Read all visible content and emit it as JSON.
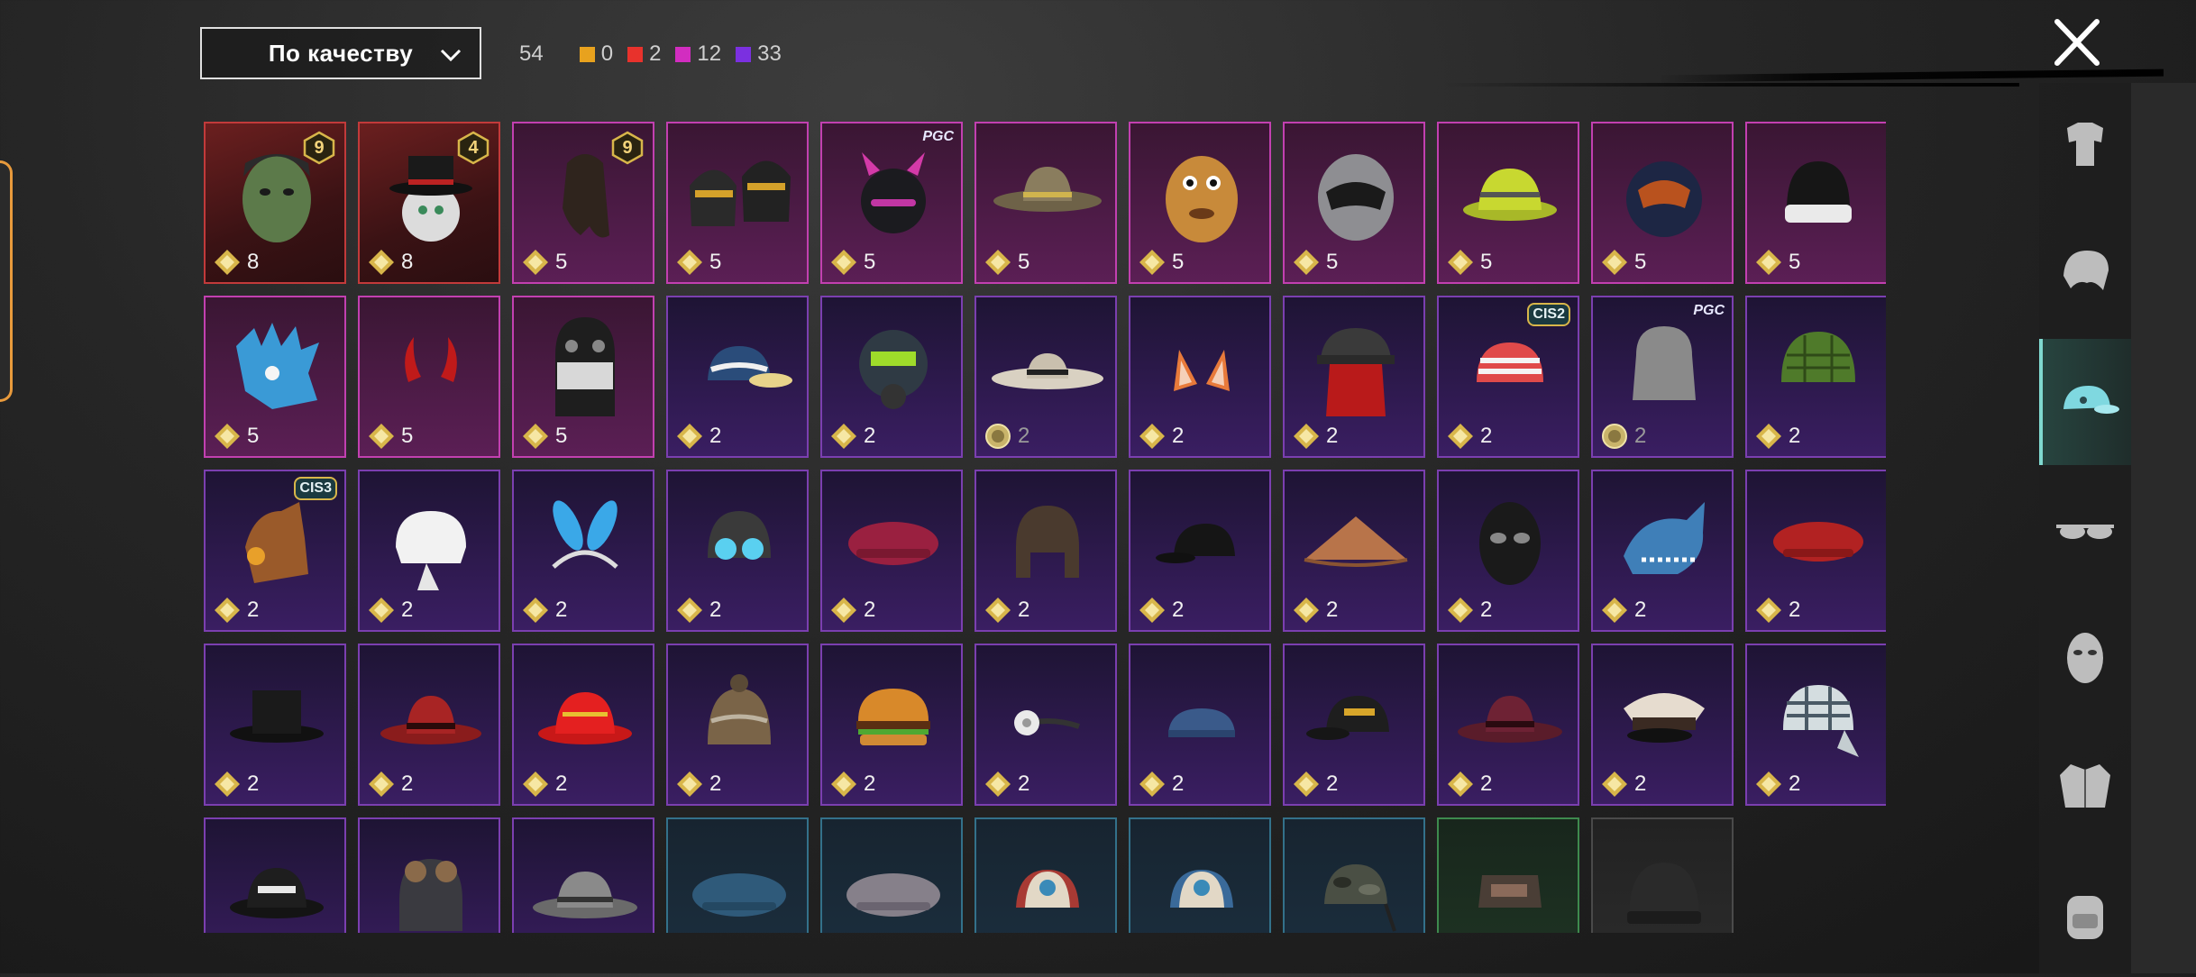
{
  "sort": {
    "label": "По качеству",
    "icon": "chevron-down-icon"
  },
  "counts": {
    "total": "54",
    "items": [
      {
        "color": "#e8a21e",
        "value": "0"
      },
      {
        "color": "#e8322c",
        "value": "2"
      },
      {
        "color": "#d22dc0",
        "value": "12"
      },
      {
        "color": "#7b30e0",
        "value": "33"
      }
    ]
  },
  "close_icon": "close-icon",
  "grid": {
    "rows": [
      [
        {
          "name": "zombie-head-mask",
          "quality": "red",
          "count": "8",
          "badge": "9",
          "art": "zombie"
        },
        {
          "name": "pumpkin-tophat-mask",
          "quality": "red",
          "count": "8",
          "badge": "4",
          "art": "tophat-ball"
        },
        {
          "name": "long-hair",
          "quality": "pink",
          "count": "5",
          "badge": "9",
          "art": "hair-long"
        },
        {
          "name": "twin-cyber-helmets",
          "quality": "pink",
          "count": "5",
          "art": "twin-helmet"
        },
        {
          "name": "horned-helmet",
          "quality": "pink",
          "count": "5",
          "tag": "PGC",
          "art": "horn-helmet"
        },
        {
          "name": "straw-cowboy-hat",
          "quality": "pink",
          "count": "5",
          "art": "cowboy-hat"
        },
        {
          "name": "potato-head",
          "quality": "pink",
          "count": "5",
          "art": "potato"
        },
        {
          "name": "racing-helmet",
          "quality": "pink",
          "count": "5",
          "art": "racing-helmet"
        },
        {
          "name": "yellow-bucket-hat",
          "quality": "pink",
          "count": "5",
          "art": "bucket-yellow"
        },
        {
          "name": "astronaut-helmet",
          "quality": "pink",
          "count": "5",
          "art": "astro-helmet"
        },
        {
          "name": "black-white-beanie",
          "quality": "pink",
          "count": "5",
          "art": "beanie"
        }
      ],
      [
        {
          "name": "blue-dragon-mask",
          "quality": "pink",
          "count": "5",
          "art": "dragon"
        },
        {
          "name": "red-devil-horns",
          "quality": "pink",
          "count": "5",
          "art": "devil-horns"
        },
        {
          "name": "skull-balaclava",
          "quality": "pink",
          "count": "5",
          "art": "skull-mask"
        },
        {
          "name": "patterned-cap",
          "quality": "purple",
          "count": "2",
          "art": "cap-blue"
        },
        {
          "name": "gas-mask-helmet",
          "quality": "purple",
          "count": "2",
          "art": "gasmask"
        },
        {
          "name": "wide-sun-hat",
          "quality": "purple",
          "count": "2",
          "coin": true,
          "art": "sunhat"
        },
        {
          "name": "fox-ears",
          "quality": "purple",
          "count": "2",
          "art": "fox-ears"
        },
        {
          "name": "bucket-hat-red-hair",
          "quality": "purple",
          "count": "2",
          "art": "bucket-hair"
        },
        {
          "name": "striped-bandana",
          "quality": "purple",
          "count": "2",
          "tag": "CIS2",
          "art": "bandana"
        },
        {
          "name": "silver-bob-hair",
          "quality": "purple",
          "count": "2",
          "coin": true,
          "tag": "PGC",
          "art": "bob-hair"
        },
        {
          "name": "green-netted-helmet",
          "quality": "purple",
          "count": "2",
          "art": "green-helmet"
        }
      ],
      [
        {
          "name": "mechanical-fox-mask",
          "quality": "purple",
          "count": "2",
          "tag": "CIS3",
          "art": "mech-fox"
        },
        {
          "name": "white-turban",
          "quality": "purple",
          "count": "2",
          "art": "turban"
        },
        {
          "name": "bunny-ears-headband",
          "quality": "purple",
          "count": "2",
          "art": "bunny-ears"
        },
        {
          "name": "goggles-beanie",
          "quality": "purple",
          "count": "2",
          "art": "goggles-beanie"
        },
        {
          "name": "maroon-beret",
          "quality": "purple",
          "count": "2",
          "art": "beret-maroon"
        },
        {
          "name": "aviator-cap",
          "quality": "purple",
          "count": "2",
          "art": "aviator"
        },
        {
          "name": "black-cap",
          "quality": "purple",
          "count": "2",
          "art": "cap-black"
        },
        {
          "name": "conical-hat",
          "quality": "purple",
          "count": "2",
          "art": "conical"
        },
        {
          "name": "black-luchador-mask",
          "quality": "purple",
          "count": "2",
          "art": "luchador"
        },
        {
          "name": "shark-hat",
          "quality": "purple",
          "count": "2",
          "art": "shark"
        },
        {
          "name": "red-beret",
          "quality": "purple",
          "count": "2",
          "art": "beret-red"
        }
      ],
      [
        {
          "name": "black-top-hat",
          "quality": "purple",
          "count": "2",
          "art": "tophat"
        },
        {
          "name": "red-fedora",
          "quality": "purple",
          "count": "2",
          "art": "fedora-red"
        },
        {
          "name": "red-bucket-hat",
          "quality": "purple",
          "count": "2",
          "art": "bucket-red"
        },
        {
          "name": "knitted-pom-hat",
          "quality": "purple",
          "count": "2",
          "art": "knit-hat"
        },
        {
          "name": "burger-hat",
          "quality": "purple",
          "count": "2",
          "art": "burger"
        },
        {
          "name": "head-mirror",
          "quality": "purple",
          "count": "2",
          "art": "head-mirror"
        },
        {
          "name": "blue-garrison-cap",
          "quality": "purple",
          "count": "2",
          "art": "garrison"
        },
        {
          "name": "black-logo-cap",
          "quality": "purple",
          "count": "2",
          "art": "cap-logo"
        },
        {
          "name": "maroon-fedora",
          "quality": "purple",
          "count": "2",
          "art": "fedora-maroon"
        },
        {
          "name": "peaked-officer-cap",
          "quality": "purple",
          "count": "2",
          "art": "officer"
        },
        {
          "name": "patterned-doo-rag",
          "quality": "purple",
          "count": "2",
          "art": "doorag"
        }
      ],
      [
        {
          "name": "black-white-bucket-hat",
          "quality": "purple",
          "art": "bucket-bw"
        },
        {
          "name": "pilot-leather-cap",
          "quality": "purple",
          "art": "pilot"
        },
        {
          "name": "camo-boonie-hat",
          "quality": "purple",
          "art": "boonie"
        },
        {
          "name": "blue-beret",
          "quality": "blue",
          "art": "beret-blue"
        },
        {
          "name": "gray-beret",
          "quality": "blue",
          "art": "beret-gray"
        },
        {
          "name": "trucker-cap-red",
          "quality": "blue",
          "art": "trucker-red"
        },
        {
          "name": "trucker-cap-blue",
          "quality": "blue",
          "art": "trucker-blue"
        },
        {
          "name": "camo-radio-cap",
          "quality": "blue",
          "art": "camo-cap"
        },
        {
          "name": "patrol-cap",
          "quality": "green",
          "art": "patrol"
        },
        {
          "name": "black-beanie",
          "quality": "gray",
          "art": "beanie-black"
        }
      ]
    ]
  },
  "sidebar": {
    "items": [
      {
        "name": "sidebar-item-outfits",
        "icon": "outfit-icon",
        "active": false
      },
      {
        "name": "sidebar-item-hair",
        "icon": "hair-icon",
        "active": false
      },
      {
        "name": "sidebar-item-hats",
        "icon": "cap-icon",
        "active": true
      },
      {
        "name": "sidebar-item-eyewear",
        "icon": "glasses-icon",
        "active": false
      },
      {
        "name": "sidebar-item-masks",
        "icon": "mask-icon",
        "active": false
      },
      {
        "name": "sidebar-item-tops",
        "icon": "jacket-icon",
        "active": false
      },
      {
        "name": "sidebar-item-backpacks",
        "icon": "backpack-icon",
        "active": false
      }
    ]
  }
}
